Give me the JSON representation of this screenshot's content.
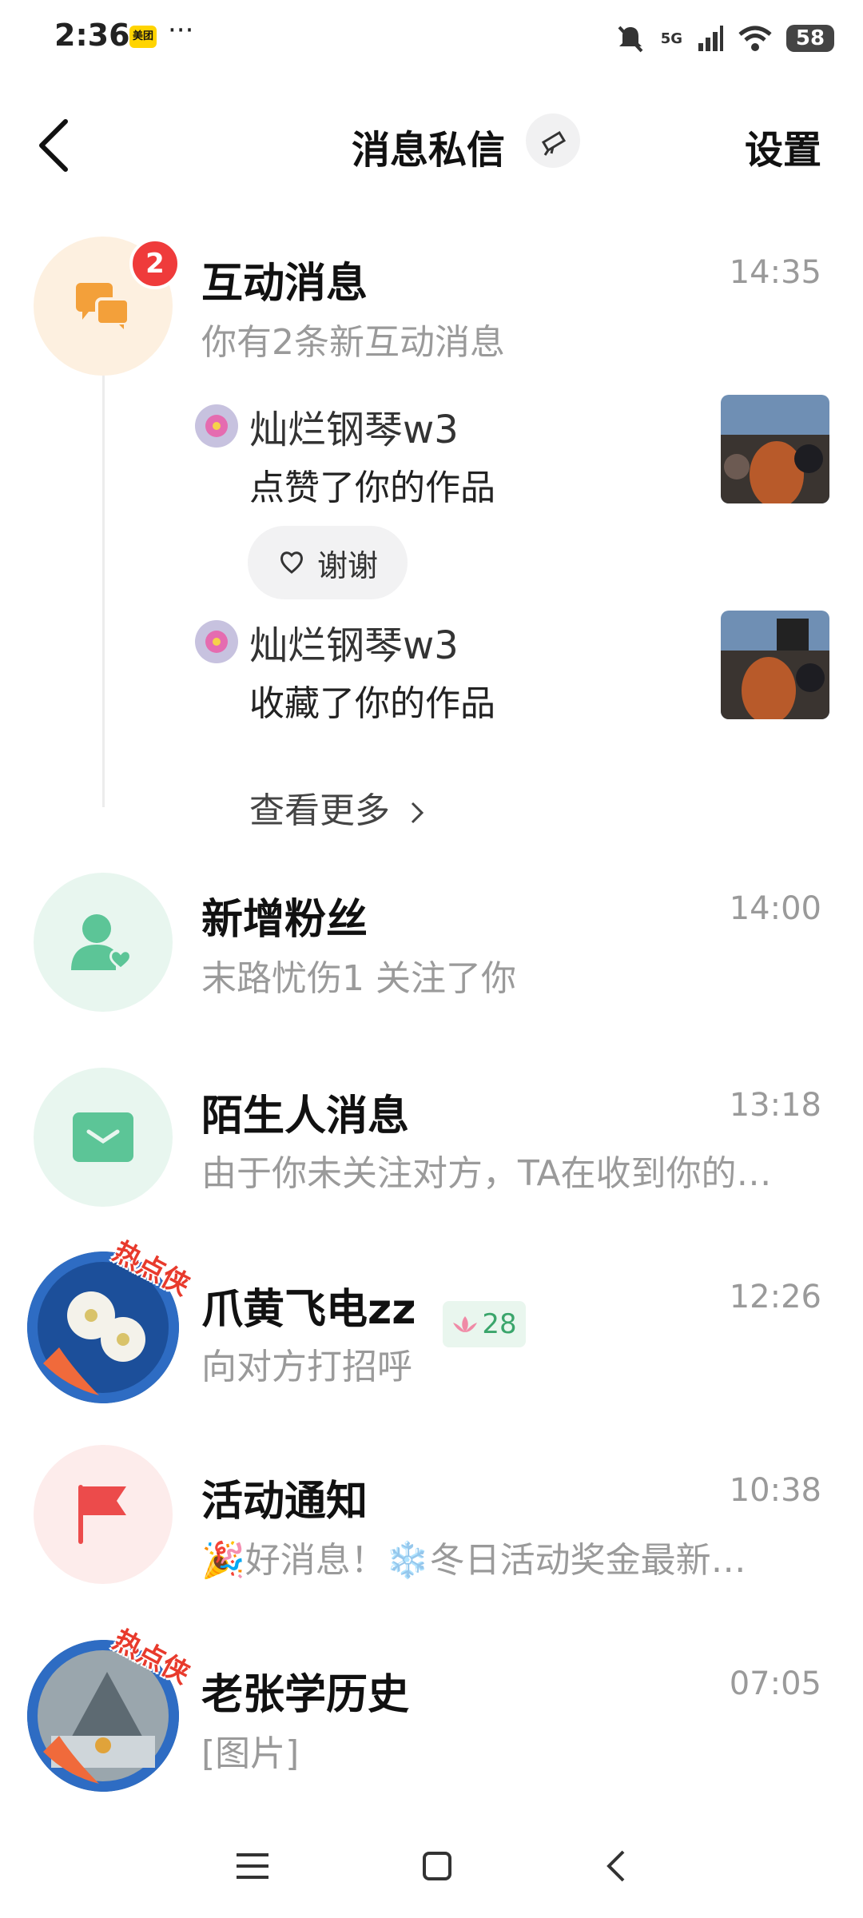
{
  "status_bar": {
    "time": "2:36",
    "app_icon_label": "美团",
    "more": "···",
    "battery": "58",
    "network": "5G"
  },
  "header": {
    "title": "消息私信",
    "settings_label": "设置"
  },
  "interaction": {
    "title": "互动消息",
    "time": "14:35",
    "subtitle": "你有2条新互动消息",
    "badge_count": "2",
    "items": [
      {
        "user": "灿烂钢琴w3",
        "action": "点赞了你的作品"
      },
      {
        "user": "灿烂钢琴w3",
        "action": "收藏了你的作品"
      }
    ],
    "thanks_label": "谢谢",
    "see_more": "查看更多"
  },
  "new_fans": {
    "title": "新增粉丝",
    "time": "14:00",
    "subtitle": "末路忧伤1 关注了你"
  },
  "stranger": {
    "title": "陌生人消息",
    "time": "13:18",
    "subtitle": "由于你未关注对方，TA在收到你的…"
  },
  "chat1": {
    "title": "爪黄飞电zz",
    "level": "28",
    "time": "12:26",
    "subtitle": "向对方打招呼",
    "hot_badge": "热点侠"
  },
  "activity": {
    "title": "活动通知",
    "time": "10:38",
    "subtitle": "🎉好消息！❄️冬日活动奖金最新…"
  },
  "chat2": {
    "title": "老张学历史",
    "time": "07:05",
    "subtitle": "[图片]",
    "hot_badge": "热点侠"
  },
  "colors": {
    "interaction_bg": "#fdf0e0",
    "interaction_icon": "#f3a03a",
    "fans_bg": "#e8f6ef",
    "fans_icon": "#5cc597",
    "activity_bg": "#fdeceb",
    "activity_icon": "#ec4b4b",
    "badge": "#ef3b3b"
  }
}
